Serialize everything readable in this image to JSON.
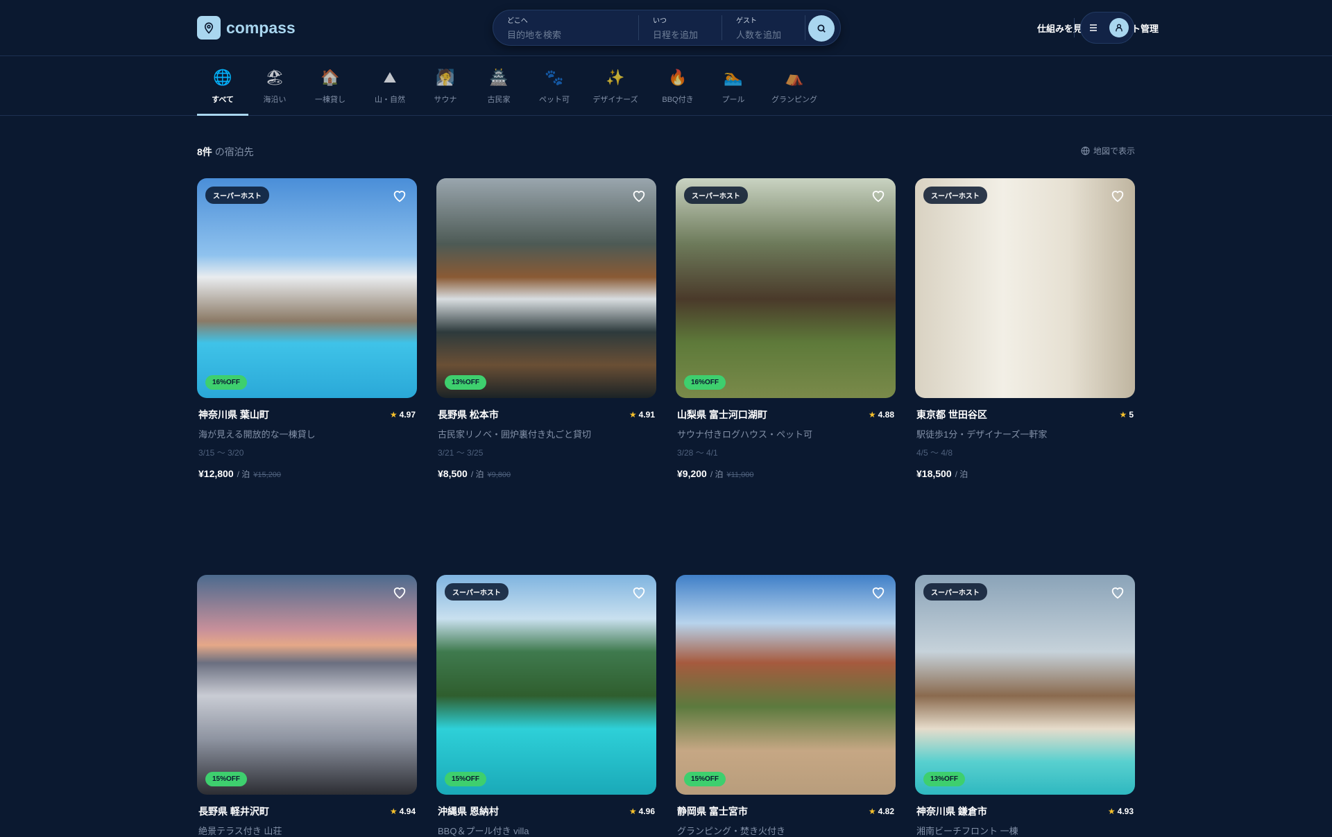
{
  "header": {
    "brand": "compass",
    "search": {
      "where_label": "どこへ",
      "where_placeholder": "目的地を検索",
      "when_label": "いつ",
      "when_placeholder": "日程を追加",
      "guest_label": "ゲスト",
      "guest_placeholder": "人数を追加"
    },
    "links": [
      "仕組みを見る",
      "ホスト管理"
    ]
  },
  "categories": [
    {
      "icon": "🌐",
      "label": "すべて"
    },
    {
      "icon": "🏖",
      "label": "海沿い"
    },
    {
      "icon": "🏠",
      "label": "一棟貸し"
    },
    {
      "icon": "⛰",
      "label": "山・自然"
    },
    {
      "icon": "🧖",
      "label": "サウナ"
    },
    {
      "icon": "🏯",
      "label": "古民家"
    },
    {
      "icon": "🐾",
      "label": "ペット可"
    },
    {
      "icon": "✨",
      "label": "デザイナーズ"
    },
    {
      "icon": "🔥",
      "label": "BBQ付き"
    },
    {
      "icon": "🏊",
      "label": "プール"
    },
    {
      "icon": "⛺",
      "label": "グランピング"
    }
  ],
  "results": {
    "count": "8件",
    "suffix": "の宿泊先",
    "map_label": "地図で表示"
  },
  "listings": [
    {
      "superhost": "スーパーホスト",
      "discount": "16%OFF",
      "title": "神奈川県 葉山町",
      "rating": "4.97",
      "desc": "海が見える開放的な一棟貸し",
      "dates": "3/15 〜 3/20",
      "price": "¥12,800",
      "per": "/ 泊",
      "orig": "¥15,200",
      "bg": "linear-gradient(180deg,#4a8ed8 0%,#8fc2ee 35%,#e9ecef 45%,#8b7a66 65%,#3fc3e8 75%,#2aa8d8 100%)"
    },
    {
      "superhost": "",
      "discount": "13%OFF",
      "title": "長野県 松本市",
      "rating": "4.91",
      "desc": "古民家リノベ・囲炉裏付き丸ごと貸切",
      "dates": "3/21 〜 3/25",
      "price": "¥8,500",
      "per": "/ 泊",
      "orig": "¥9,800",
      "bg": "linear-gradient(180deg,#9aa6ae 0%,#4d5a55 30%,#8a5a34 45%,#d8dde0 55%,#2d3a3c 70%,#6a4f35 85%,#1b2326 100%)"
    },
    {
      "superhost": "スーパーホスト",
      "discount": "16%OFF",
      "title": "山梨県 富士河口湖町",
      "rating": "4.88",
      "desc": "サウナ付きログハウス・ペット可",
      "dates": "3/28 〜 4/1",
      "price": "¥9,200",
      "per": "/ 泊",
      "orig": "¥11,000",
      "bg": "linear-gradient(180deg,#c9d3c2 0%,#6d7a5a 30%,#4a3a2a 55%,#5e7a3a 75%,#7a8a4a 100%)"
    },
    {
      "superhost": "スーパーホスト",
      "discount": "",
      "title": "東京都 世田谷区",
      "rating": "5",
      "desc": "駅徒歩1分・デザイナーズ一軒家",
      "dates": "4/5 〜 4/8",
      "price": "¥18,500",
      "per": "/ 泊",
      "orig": "",
      "bg": "linear-gradient(90deg,#d9d2c2 0%,#f2efe6 40%,#e6e0d2 70%,#bfb5a0 100%)"
    },
    {
      "superhost": "",
      "discount": "15%OFF",
      "title": "長野県 軽井沢町",
      "rating": "4.94",
      "desc": "絶景テラス付き 山荘",
      "dates": "",
      "price": "",
      "per": "",
      "orig": "",
      "bg": "linear-gradient(180deg,#4b6a8e 0%,#c8909a 25%,#e5a888 32%,#6b6f80 40%,#c9ccd4 55%,#8d93a0 75%,#2c2d33 100%)"
    },
    {
      "superhost": "スーパーホスト",
      "discount": "15%OFF",
      "title": "沖縄県 恩納村",
      "rating": "4.96",
      "desc": "BBQ＆プール付き villa",
      "dates": "",
      "price": "",
      "per": "",
      "orig": "",
      "bg": "linear-gradient(180deg,#7fb4e0 0%,#c9e0ef 20%,#3f7a4e 35%,#2f5e2e 55%,#2ed0d8 70%,#1aa9b8 100%)"
    },
    {
      "superhost": "",
      "discount": "15%OFF",
      "title": "静岡県 富士宮市",
      "rating": "4.82",
      "desc": "グランピング・焚き火付き",
      "dates": "",
      "price": "",
      "per": "",
      "orig": "",
      "bg": "linear-gradient(180deg,#3f7fc8 0%,#b7d3ec 22%,#a65a3e 40%,#5c7a3e 60%,#c6a784 80%,#b89d7c 100%)"
    },
    {
      "superhost": "スーパーホスト",
      "discount": "13%OFF",
      "title": "神奈川県 鎌倉市",
      "rating": "4.93",
      "desc": "湘南ビーチフロント 一棟",
      "dates": "",
      "price": "",
      "per": "",
      "orig": "",
      "bg": "linear-gradient(180deg,#8aa3b8 0%,#c6d2da 35%,#8a6a4e 55%,#e6dccb 70%,#58d0cf 85%,#2fb8c0 100%)"
    }
  ]
}
